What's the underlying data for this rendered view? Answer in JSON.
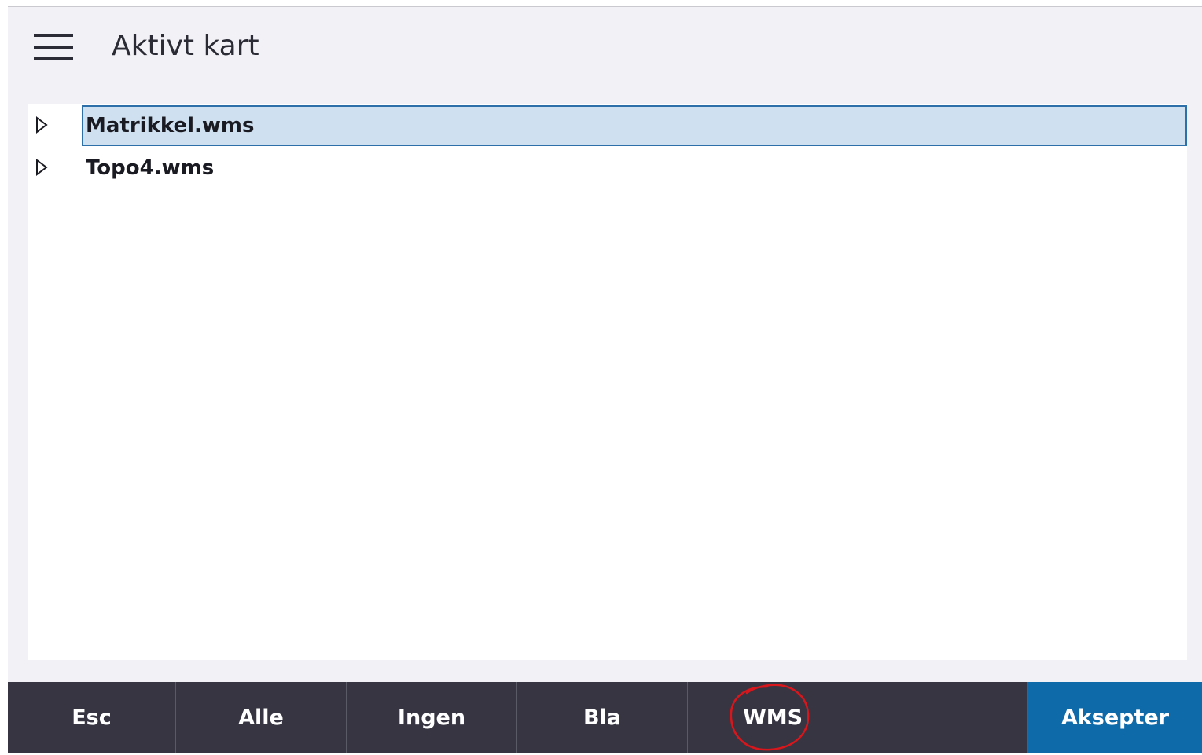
{
  "header": {
    "title": "Aktivt kart"
  },
  "tree": {
    "items": [
      {
        "label": "Matrikkel.wms",
        "selected": true,
        "expander_icon": "triangle-right-icon"
      },
      {
        "label": "Topo4.wms",
        "selected": false,
        "expander_icon": "triangle-right-icon"
      }
    ]
  },
  "toolbar": {
    "esc_label": "Esc",
    "alle_label": "Alle",
    "ingen_label": "Ingen",
    "bla_label": "Bla",
    "wms_label": "WMS",
    "aksepter_label": "Aksepter"
  },
  "colors": {
    "background": "#f2f1f6",
    "panel": "#ffffff",
    "selection_fill": "#cfe1f0",
    "selection_border": "#2d6fa8",
    "toolbar": "#363541",
    "accept_button": "#0f6aa9",
    "annotation": "#d9161b"
  }
}
